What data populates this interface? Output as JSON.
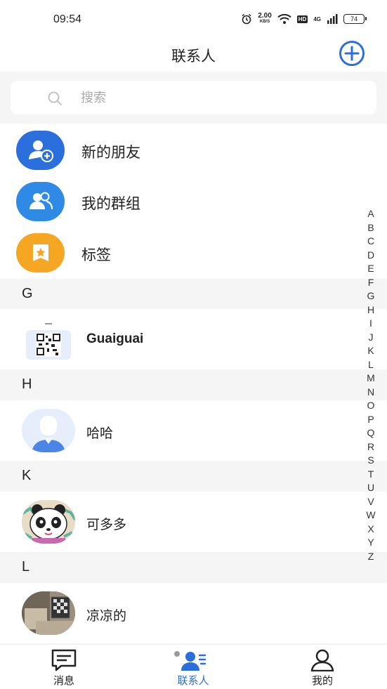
{
  "status_bar": {
    "time": "09:54",
    "net_speed": "2.00",
    "net_speed_unit": "KB/S",
    "hd_label": "HD",
    "network_label": "4G",
    "battery": "74",
    "icons": [
      "alarm-icon",
      "wifi-icon",
      "signal-icon",
      "battery-icon"
    ]
  },
  "header": {
    "title": "联系人",
    "add_icon": "plus-circle-icon",
    "accent_color": "#2a6fdb"
  },
  "search": {
    "placeholder": "搜索",
    "value": ""
  },
  "menu": [
    {
      "label": "新的朋友",
      "icon": "add-friend-icon",
      "color": "#2a6fdb"
    },
    {
      "label": "我的群组",
      "icon": "group-icon",
      "color": "#2f8ae6"
    },
    {
      "label": "标签",
      "icon": "tag-star-icon",
      "color": "#f5a623"
    }
  ],
  "sections": [
    {
      "letter": "G",
      "contacts": [
        {
          "name": "Guaiguai",
          "avatar": "qr-code-avatar"
        }
      ]
    },
    {
      "letter": "H",
      "contacts": [
        {
          "name": "哈哈",
          "avatar": "default-person-avatar"
        }
      ]
    },
    {
      "letter": "K",
      "contacts": [
        {
          "name": "可多多",
          "avatar": "panda-avatar"
        }
      ]
    },
    {
      "letter": "L",
      "contacts": [
        {
          "name": "凉凉的",
          "avatar": "photo-avatar"
        }
      ]
    }
  ],
  "alpha_index": [
    "A",
    "B",
    "C",
    "D",
    "E",
    "F",
    "G",
    "H",
    "I",
    "J",
    "K",
    "L",
    "M",
    "N",
    "O",
    "P",
    "Q",
    "R",
    "S",
    "T",
    "U",
    "V",
    "W",
    "X",
    "Y",
    "Z"
  ],
  "tabs": [
    {
      "label": "消息",
      "icon": "message-icon",
      "active": false
    },
    {
      "label": "联系人",
      "icon": "contacts-icon",
      "active": true
    },
    {
      "label": "我的",
      "icon": "profile-icon",
      "active": false
    }
  ]
}
